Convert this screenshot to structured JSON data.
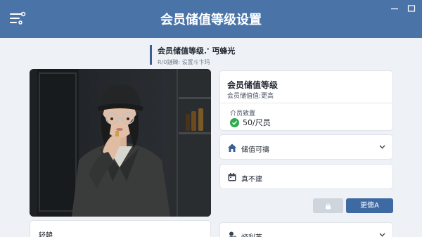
{
  "header": {
    "title": "会员储值等级设置",
    "icons": {
      "menu": "settings-menu-icon",
      "minimize": "minimize-icon",
      "maximize": "maximize-icon"
    }
  },
  "subheader": {
    "title": "会员储值等级.' 丏蜂光",
    "desc": "R/0鏈礫: 设置斗卞玛"
  },
  "photo": {
    "name": "person-photo"
  },
  "level_card": {
    "title": "会员储值等级",
    "subtitle": "会员储值值:更高",
    "field_label": "介员致置",
    "field_value": "50/尺员"
  },
  "rows": [
    {
      "label": "储值可禱",
      "icon": "home-icon"
    },
    {
      "label": "真不建",
      "icon": "calendar-icon"
    },
    {
      "label": "烃利茧",
      "icon": "user-icon"
    }
  ],
  "buttons": {
    "primary": "更傯A",
    "disabled_icon": "lock-icon"
  },
  "bottom_left": {
    "label": "轻韓"
  },
  "colors": {
    "header": "#4a74a8",
    "primary": "#3e6aa3",
    "success": "#2eaa4f"
  }
}
